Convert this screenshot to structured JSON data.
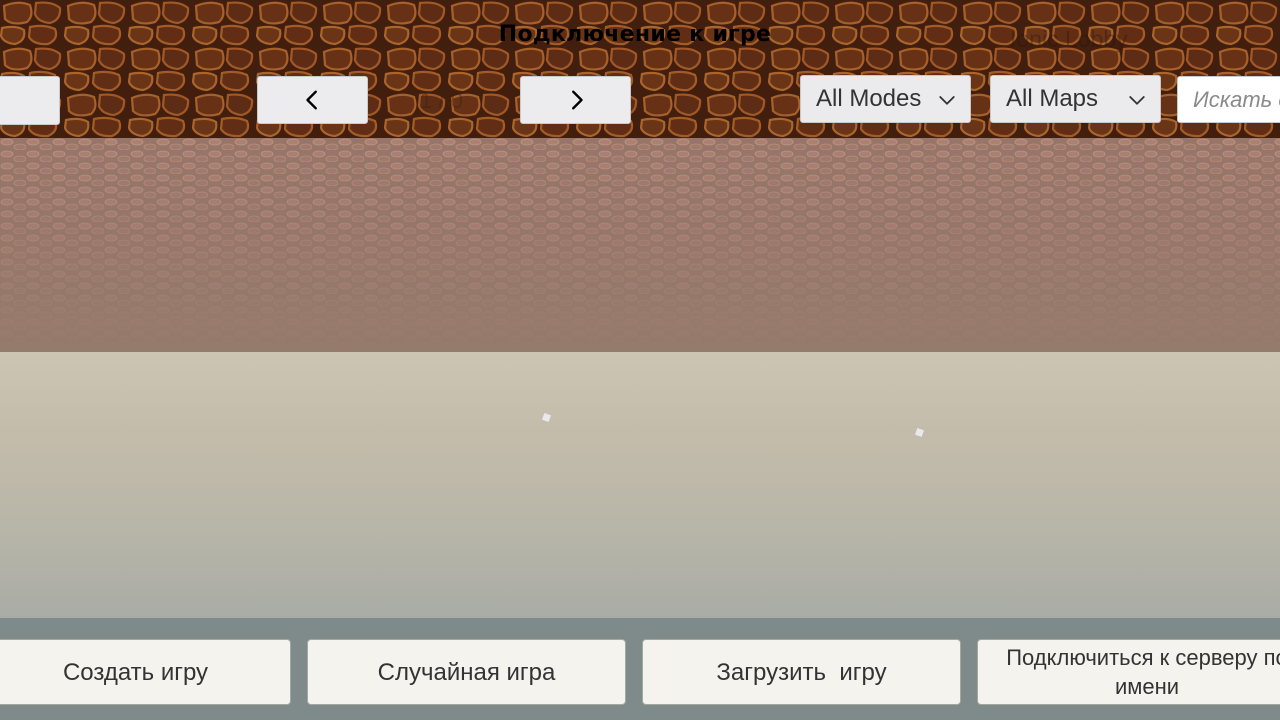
{
  "header": {
    "title": "Подключение к игре",
    "lobby_label": "Ionic Lobby",
    "page_indicator": "1 / 0",
    "prev_icon": "chevron-left-icon",
    "next_icon": "chevron-right-icon"
  },
  "filters": {
    "modes_value": "All Modes",
    "maps_value": "All Maps",
    "dropdown_icon": "chevron-down-icon",
    "search_placeholder": "Искать сервер"
  },
  "actions": {
    "create_label": "Создать игру",
    "random_label": "Случайная игра",
    "load_label": "Загрузить  игру",
    "connect_label_line1": "Подключиться к серверу по",
    "connect_label_line2": "имени"
  },
  "colors": {
    "topbar_base": "#5a2a14",
    "topbar_pattern": "#b8602a",
    "button_bg": "#ecebee",
    "bottombar_bg": "#7f8b8b",
    "ground": "#c4bcaa"
  }
}
